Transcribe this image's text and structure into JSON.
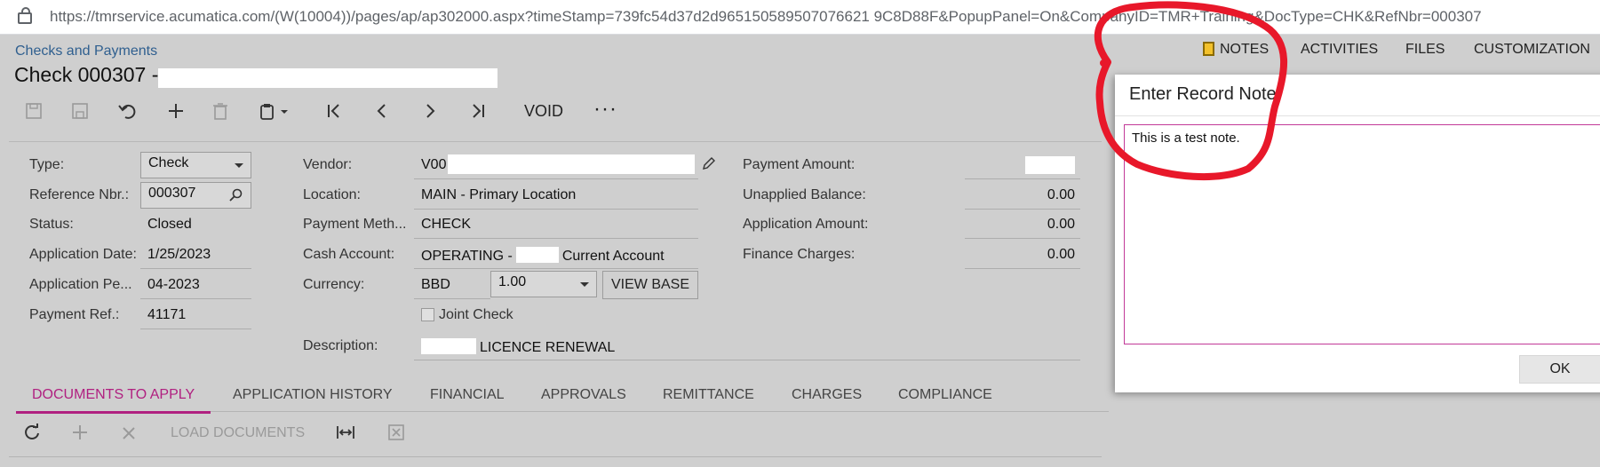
{
  "browser": {
    "url": "https://tmrservice.acumatica.com/(W(10004))/pages/ap/ap302000.aspx?timeStamp=739fc54d37d2d965150589507076621 9C8D88F&PopupPanel=On&CompanyID=TMR+Training&DocType=CHK&RefNbr=000307"
  },
  "page": {
    "breadcrumb": "Checks and Payments",
    "title": "Check 000307 -"
  },
  "toolbar": {
    "void_label": "VOID",
    "more_label": "···"
  },
  "header_buttons": {
    "notes": "NOTES",
    "activities": "ACTIVITIES",
    "files": "FILES",
    "customization": "CUSTOMIZATION"
  },
  "form": {
    "type_label": "Type:",
    "type_value": "Check",
    "ref_label": "Reference Nbr.:",
    "ref_value": "000307",
    "status_label": "Status:",
    "status_value": "Closed",
    "appdate_label": "Application Date:",
    "appdate_value": "1/25/2023",
    "appperiod_label": "Application Pe...",
    "appperiod_value": "04-2023",
    "payref_label": "Payment Ref.:",
    "payref_value": "41171",
    "vendor_label": "Vendor:",
    "vendor_value": "V00",
    "location_label": "Location:",
    "location_value": "MAIN - Primary Location",
    "paymeth_label": "Payment Meth...",
    "paymeth_value": "CHECK",
    "cash_label": "Cash Account:",
    "cash_value_a": "OPERATING -",
    "cash_value_b": "Current Account",
    "currency_label": "Currency:",
    "currency_value": "BBD",
    "rate_value": "1.00",
    "viewbase_label": "VIEW BASE",
    "joint_label": "Joint Check",
    "desc_label": "Description:",
    "desc_value": "LICENCE RENEWAL",
    "payamt_label": "Payment Amount:",
    "unapplied_label": "Unapplied Balance:",
    "unapplied_value": "0.00",
    "appamt_label": "Application Amount:",
    "appamt_value": "0.00",
    "fincharge_label": "Finance Charges:",
    "fincharge_value": "0.00"
  },
  "tabs": [
    {
      "label": "DOCUMENTS TO APPLY"
    },
    {
      "label": "APPLICATION HISTORY"
    },
    {
      "label": "FINANCIAL"
    },
    {
      "label": "APPROVALS"
    },
    {
      "label": "REMITTANCE"
    },
    {
      "label": "CHARGES"
    },
    {
      "label": "COMPLIANCE"
    }
  ],
  "grid_toolbar": {
    "load_label": "LOAD DOCUMENTS"
  },
  "modal": {
    "title": "Enter Record Note",
    "note_text": "This is a test note.",
    "ok_label": "OK"
  },
  "colors": {
    "accent": "#b02080",
    "annotation": "#e8182a",
    "link": "#2f5f8f"
  }
}
